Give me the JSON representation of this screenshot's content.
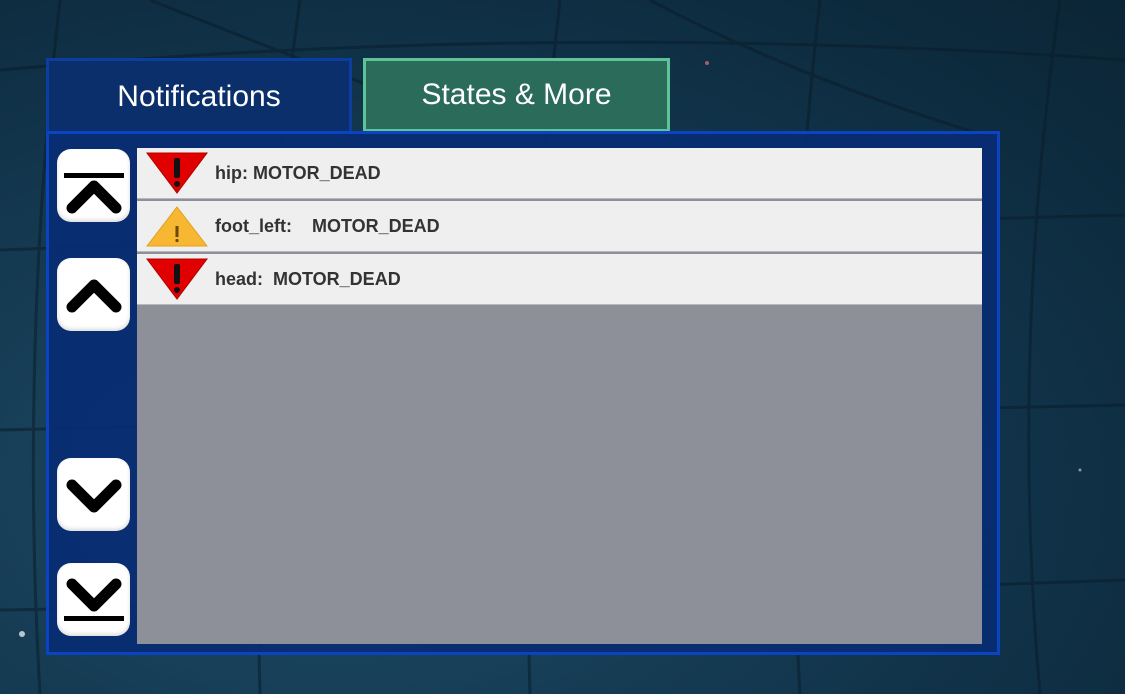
{
  "tabs": {
    "notifications": "Notifications",
    "states_more": "States & More"
  },
  "notifications": [
    {
      "severity": "error",
      "icon": "error-triangle-icon",
      "text": "hip: MOTOR_DEAD"
    },
    {
      "severity": "warning",
      "icon": "warning-triangle-icon",
      "text": "foot_left:    MOTOR_DEAD"
    },
    {
      "severity": "error",
      "icon": "error-triangle-icon",
      "text": "head:  MOTOR_DEAD"
    }
  ],
  "scroll_buttons": {
    "top": "scroll-to-top-icon",
    "up": "scroll-up-icon",
    "down": "scroll-down-icon",
    "bottom": "scroll-to-bottom-icon"
  },
  "colors": {
    "active_tab": "#2a6b5a",
    "active_tab_border": "#5fc39a",
    "inactive_tab": "#0a2f6a",
    "panel": "#082d73",
    "panel_border": "#0b44c2",
    "error": "#e00000",
    "warning": "#f7b733",
    "list_bg": "#8d9099",
    "row_bg": "#efefef"
  }
}
